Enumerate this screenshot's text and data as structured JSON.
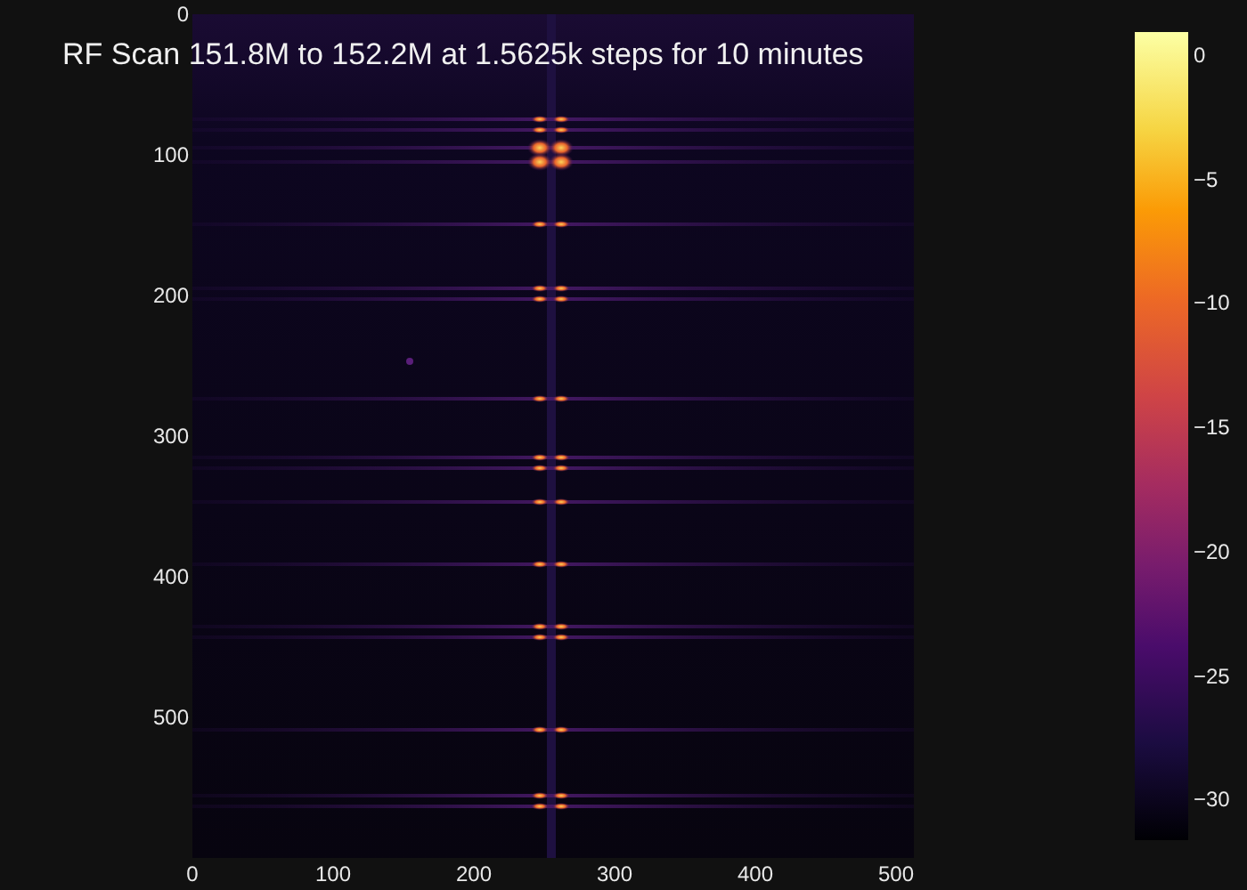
{
  "title": "RF Scan 151.8M to 152.2M at 1.5625k steps for 10 minutes",
  "y_axis": {
    "ticks": [
      "0",
      "100",
      "200",
      "300",
      "400",
      "500"
    ]
  },
  "x_axis": {
    "ticks": [
      "0",
      "100",
      "200",
      "300",
      "400",
      "500"
    ]
  },
  "colorbar": {
    "ticks": [
      "0",
      "−5",
      "−10",
      "−15",
      "−20",
      "−25",
      "−30"
    ]
  }
}
